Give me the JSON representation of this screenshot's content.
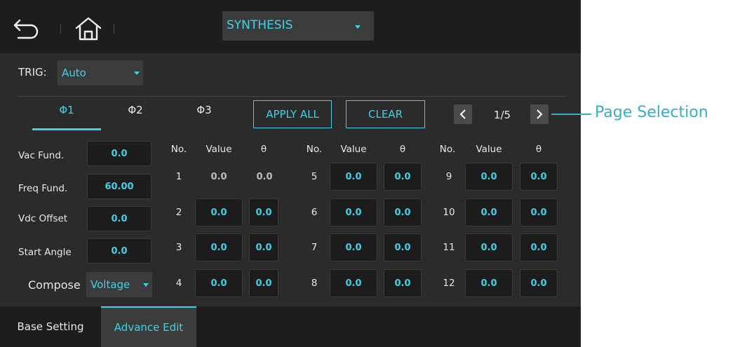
{
  "header": {
    "mode_value": "SYNTHESIS"
  },
  "trig": {
    "label": "TRIG:",
    "value": "Auto"
  },
  "tabs": [
    "Φ1",
    "Φ2",
    "Φ3"
  ],
  "actions": {
    "apply_all": "APPLY ALL",
    "clear": "CLEAR"
  },
  "pager": {
    "value": "1/5"
  },
  "fundamentals": [
    {
      "label": "Vac Fund.",
      "value": "0.0"
    },
    {
      "label": "Freq Fund.",
      "value": "60.00"
    },
    {
      "label": "Vdc Offset",
      "value": "0.0"
    },
    {
      "label": "Start Angle",
      "value": "0.0"
    }
  ],
  "compose": {
    "label": "Compose",
    "value": "Voltage"
  },
  "harmonics": {
    "headers": {
      "no": "No.",
      "value": "Value",
      "theta": "θ"
    },
    "columns": [
      {
        "rows": [
          {
            "no": "1",
            "value": "0.0",
            "theta": "0.0"
          },
          {
            "no": "2",
            "value": "0.0",
            "theta": "0.0"
          },
          {
            "no": "3",
            "value": "0.0",
            "theta": "0.0"
          },
          {
            "no": "4",
            "value": "0.0",
            "theta": "0.0"
          }
        ]
      },
      {
        "rows": [
          {
            "no": "5",
            "value": "0.0",
            "theta": "0.0"
          },
          {
            "no": "6",
            "value": "0.0",
            "theta": "0.0"
          },
          {
            "no": "7",
            "value": "0.0",
            "theta": "0.0"
          },
          {
            "no": "8",
            "value": "0.0",
            "theta": "0.0"
          }
        ]
      },
      {
        "rows": [
          {
            "no": "9",
            "value": "0.0",
            "theta": "0.0"
          },
          {
            "no": "10",
            "value": "0.0",
            "theta": "0.0"
          },
          {
            "no": "11",
            "value": "0.0",
            "theta": "0.0"
          },
          {
            "no": "12",
            "value": "0.0",
            "theta": "0.0"
          }
        ]
      }
    ]
  },
  "bottom_tabs": {
    "base": "Base Setting",
    "advance": "Advance Edit"
  },
  "callout": {
    "text": "Page Selection"
  },
  "colors": {
    "accent": "#3fd2e6",
    "panel": "#2b2b2b",
    "bar": "#1d1d1d",
    "field": "#1c1c1c",
    "callout": "#3aaec0"
  },
  "icons": [
    "back-arrow-icon",
    "home-icon",
    "caret-down-icon",
    "chevron-left-icon",
    "chevron-right-icon"
  ]
}
